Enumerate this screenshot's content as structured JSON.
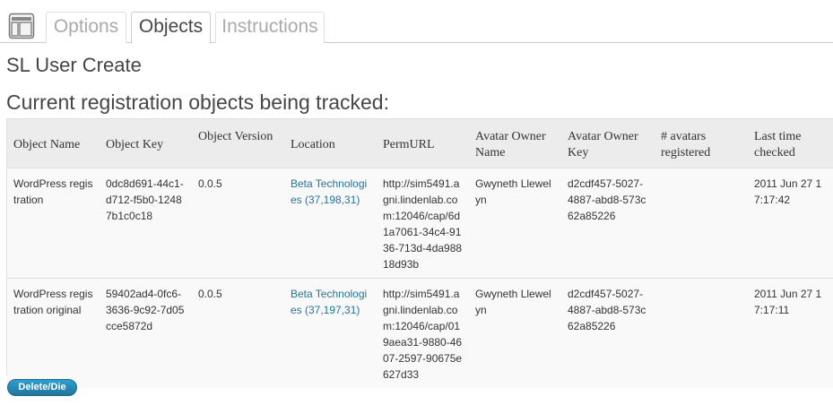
{
  "tabs": [
    {
      "label": "Options"
    },
    {
      "label": "Objects"
    },
    {
      "label": "Instructions"
    }
  ],
  "page_title": "SL User Create",
  "section_title": "Current registration objects being tracked:",
  "table": {
    "headers": [
      "Object Name",
      "Object Key",
      "Object Version",
      "Location",
      "PermURL",
      "Avatar Owner Name",
      "Avatar Owner Key",
      "# avatars registered",
      "Last time checked"
    ],
    "rows": [
      {
        "object_name": "WordPress registration",
        "object_key": "0dc8d691-44c1-d712-f5b0-12487b1c0c18",
        "object_version": "0.0.5",
        "location": "Beta Technologies (37,198,31)",
        "permurl": "http://sim5491.agni.lindenlab.com:12046/cap/6d1a7061-34c4-9136-713d-4da98818d93b",
        "owner_name": "Gwyneth Llewelyn",
        "owner_key": "d2cdf457-5027-4887-abd8-573c62a85226",
        "avatars_registered": "",
        "last_checked": "2011 Jun 27 17:17:42"
      },
      {
        "object_name": "WordPress registration original",
        "object_key": "59402ad4-0fc6-3636-9c92-7d05cce5872d",
        "object_version": "0.0.5",
        "location": "Beta Technologies (37,197,31)",
        "permurl": "http://sim5491.agni.lindenlab.com:12046/cap/019aea31-9880-4607-2597-90675e627d33",
        "owner_name": "Gwyneth Llewelyn",
        "owner_key": "d2cdf457-5027-4887-abd8-573c62a85226",
        "avatars_registered": "",
        "last_checked": "2011 Jun 27 17:17:11"
      }
    ]
  },
  "delete_button": "Delete/Die",
  "icons": {
    "screen": "settings-screen-icon"
  },
  "colors": {
    "link": "#21759b",
    "button": "#21759b"
  }
}
